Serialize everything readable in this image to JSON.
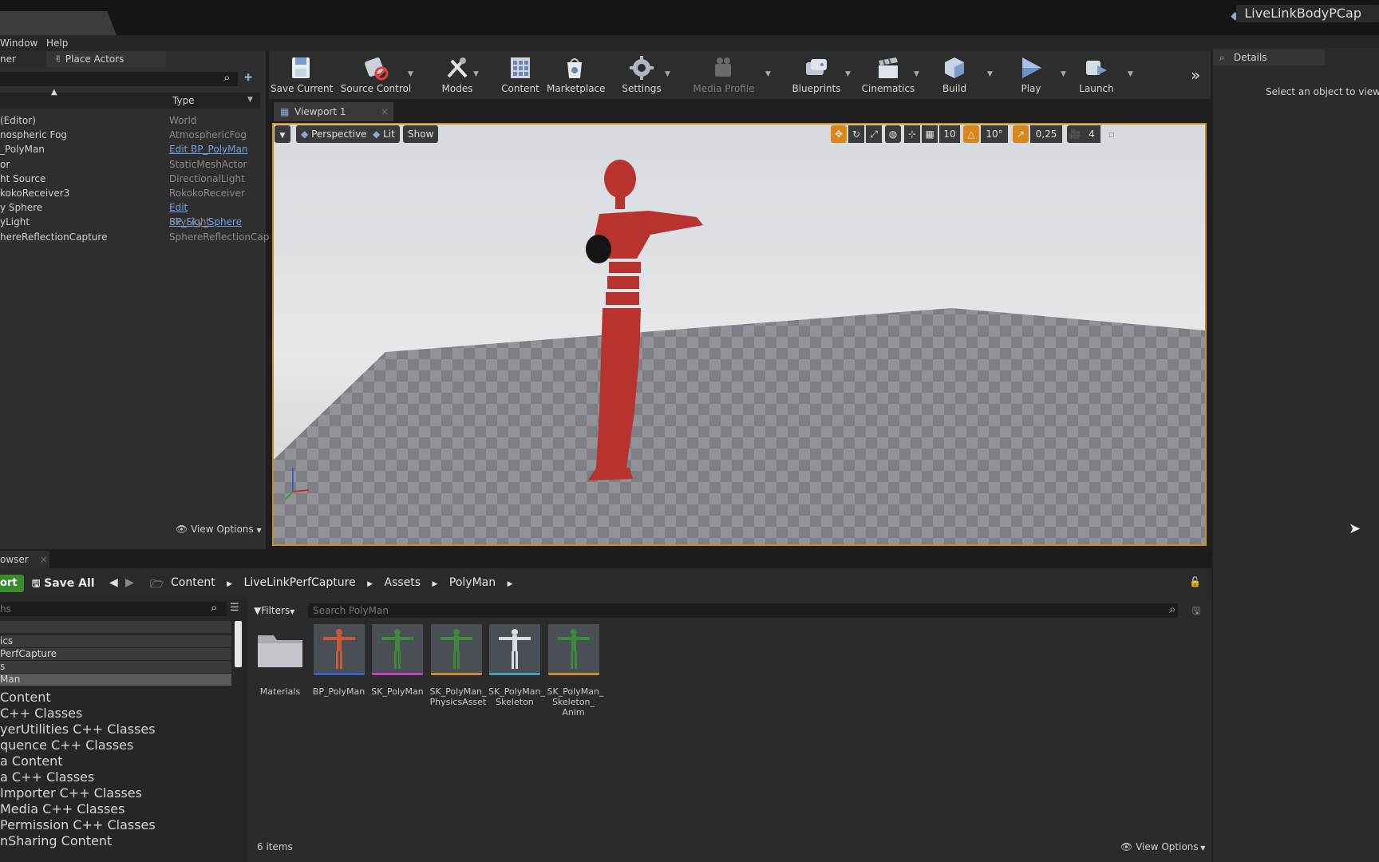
{
  "title_bar": {
    "project_name": "LiveLinkBodyPCap"
  },
  "menu": {
    "items": [
      "Window",
      "Help"
    ]
  },
  "outliner": {
    "tab_label": "ner",
    "place_actors_label": "Place Actors",
    "type_header": "Type",
    "rows": [
      {
        "name": "(Editor)",
        "type": "World",
        "link": false
      },
      {
        "name": "nospheric Fog",
        "type": "AtmosphericFog",
        "link": false
      },
      {
        "name": "_PolyMan",
        "type": "Edit BP_PolyMan",
        "link": true
      },
      {
        "name": "or",
        "type": "StaticMeshActor",
        "link": false
      },
      {
        "name": "ht Source",
        "type": "DirectionalLight",
        "link": false
      },
      {
        "name": "kokoReceiver3",
        "type": "RokokoReceiver",
        "link": false
      },
      {
        "name": "y Sphere",
        "type": "Edit BP_Sky_Sphere",
        "link": true
      },
      {
        "name": "yLight",
        "type": "SkyLight",
        "link": false
      },
      {
        "name": "hereReflectionCapture",
        "type": "SphereReflectionCap",
        "link": false
      }
    ],
    "view_options": "View Options"
  },
  "toolbar": {
    "buttons": [
      {
        "label": "Save Current",
        "icon": "save-icon"
      },
      {
        "label": "Source Control",
        "icon": "source-control-icon"
      },
      {
        "label": "Modes",
        "icon": "modes-icon"
      },
      {
        "label": "Content",
        "icon": "content-icon"
      },
      {
        "label": "Marketplace",
        "icon": "marketplace-icon"
      },
      {
        "label": "Settings",
        "icon": "settings-icon"
      },
      {
        "label": "Media Profile",
        "icon": "media-profile-icon"
      },
      {
        "label": "Blueprints",
        "icon": "blueprints-icon"
      },
      {
        "label": "Cinematics",
        "icon": "cinematics-icon"
      },
      {
        "label": "Build",
        "icon": "build-icon"
      },
      {
        "label": "Play",
        "icon": "play-icon"
      },
      {
        "label": "Launch",
        "icon": "launch-icon"
      }
    ]
  },
  "details": {
    "tab_label": "Details",
    "hint": "Select an object to view de"
  },
  "viewport": {
    "tab_label": "Viewport 1",
    "perspective": "Perspective",
    "lit": "Lit",
    "show": "Show",
    "grid_snap": "10",
    "rotation_snap": "10°",
    "scale_snap": "0,25",
    "camera_speed": "4"
  },
  "content_browser": {
    "tab_label": "owser",
    "import_label": "ort",
    "save_all": "Save All",
    "breadcrumb": [
      "Content",
      "LiveLinkPerfCapture",
      "Assets",
      "PolyMan"
    ],
    "filters": "Filters",
    "search_placeholder": "Search PolyMan",
    "paths_placeholder": "hs",
    "tree_small": [
      "ics",
      "PerfCapture",
      "s",
      "Man"
    ],
    "tree": [
      "Content",
      "C++ Classes",
      "yerUtilities C++ Classes",
      "quence C++ Classes",
      "a Content",
      "a C++ Classes",
      "Importer C++ Classes",
      "Media C++ Classes",
      "Permission C++ Classes",
      "nSharing Content"
    ],
    "assets": [
      {
        "label": "Materials",
        "kind": "folder",
        "color": ""
      },
      {
        "label": "BP_PolyMan",
        "kind": "blueprint",
        "color": "#3a5fcc"
      },
      {
        "label": "SK_PolyMan",
        "kind": "mesh",
        "color": "#c040c0"
      },
      {
        "label": "SK_PolyMan_ PhysicsAsset",
        "kind": "physics",
        "color": "#d08a30"
      },
      {
        "label": "SK_PolyMan_ Skeleton",
        "kind": "skeleton",
        "color": "#40a0c0"
      },
      {
        "label": "SK_PolyMan_ Skeleton_ Anim",
        "kind": "anim",
        "color": "#d08a30"
      }
    ],
    "item_count": "6 items",
    "view_options": "View Options"
  }
}
